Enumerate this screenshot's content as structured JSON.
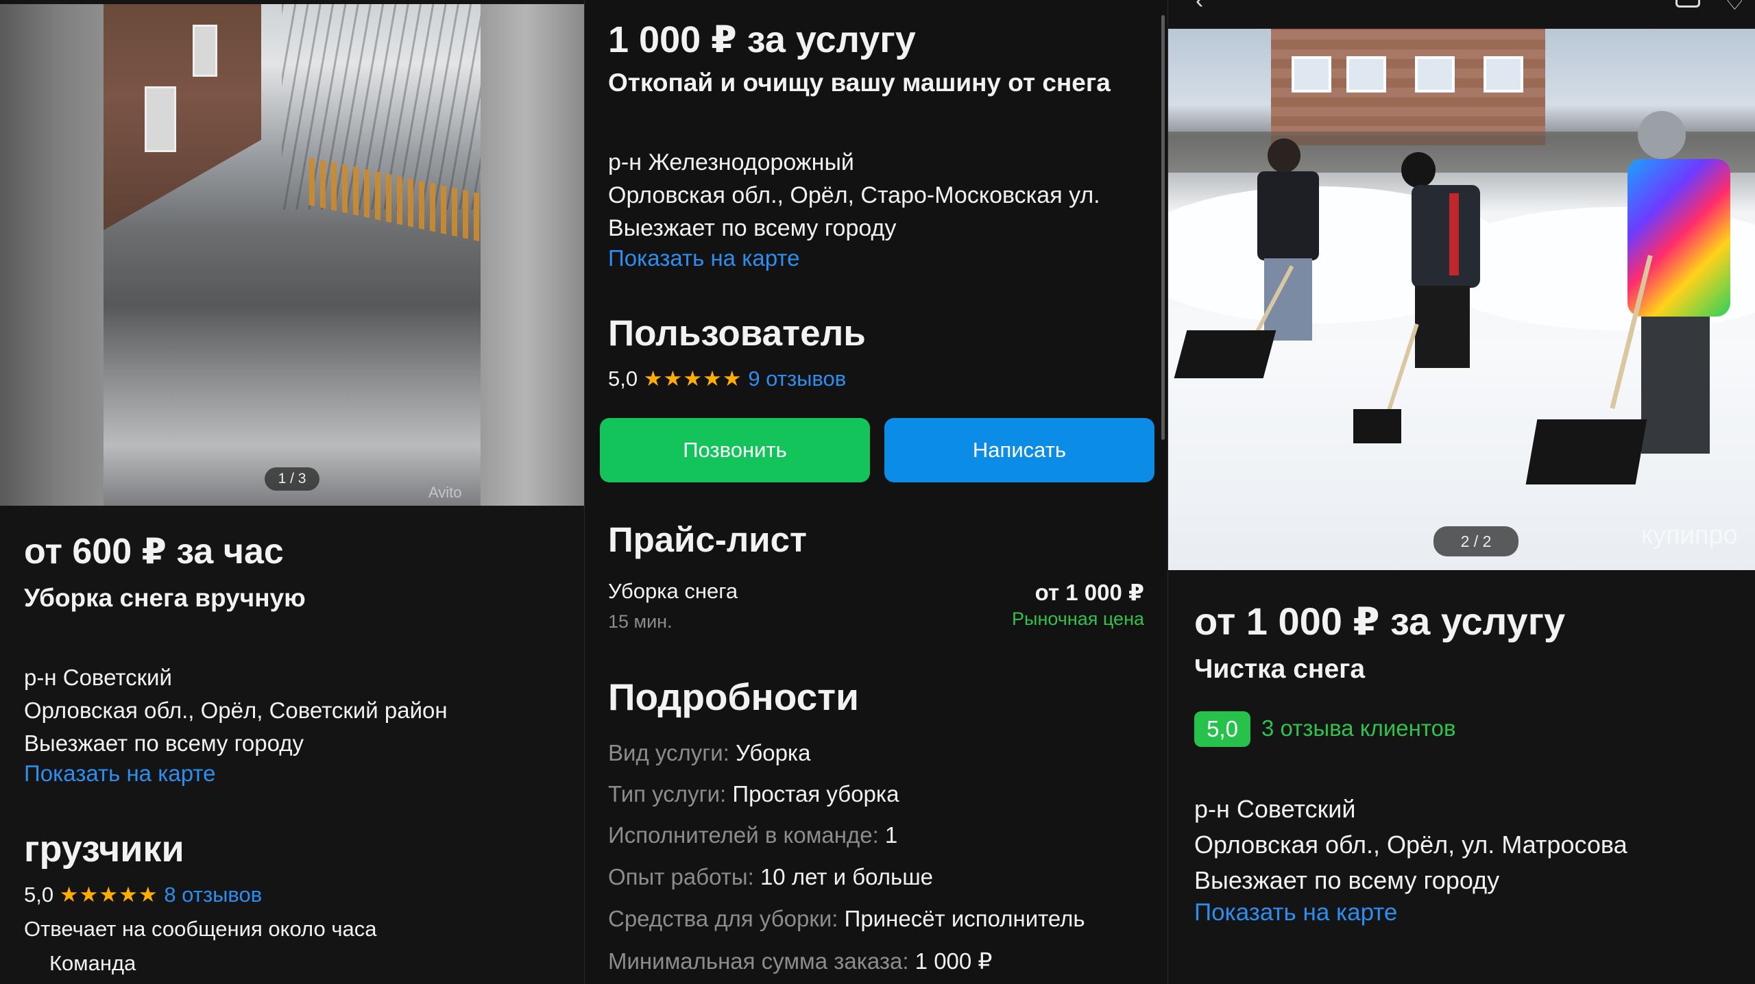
{
  "panel1": {
    "photo_counter": "1 / 3",
    "watermark": "Avito",
    "price": "от 600 ₽ за час",
    "title": "Уборка снега вручную",
    "district": "р-н Советский",
    "address": "Орловская обл., Орёл, Советский район",
    "coverage": "Выезжает по всему городу",
    "map_link": "Показать на карте",
    "seller_name": "грузчики",
    "rating_value": "5,0",
    "stars": "★★★★★",
    "reviews_link": "8 отзывов",
    "response_time": "Отвечает на сообщения около часа",
    "seller_type": "Команда"
  },
  "panel2": {
    "price": "1 000 ₽ за услугу",
    "title": "Откопай и очищу вашу машину от снега",
    "district": "р-н Железнодорожный",
    "address": "Орловская обл., Орёл, Старо-Московская ул.",
    "coverage": "Выезжает по всему городу",
    "map_link": "Показать на карте",
    "seller_heading": "Пользователь",
    "rating_value": "5,0",
    "stars": "★★★★★",
    "reviews_link": "9 отзывов",
    "call_button": "Позвонить",
    "write_button": "Написать",
    "pricelist_heading": "Прайс-лист",
    "pricelist_item": {
      "name": "Уборка снега",
      "duration": "15 мин.",
      "price": "от 1 000 ₽",
      "note": "Рыночная цена"
    },
    "details_heading": "Подробности",
    "details": [
      {
        "label": "Вид услуги:",
        "value": "Уборка"
      },
      {
        "label": "Тип услуги:",
        "value": "Простая уборка"
      },
      {
        "label": "Исполнителей в команде:",
        "value": "1"
      },
      {
        "label": "Опыт работы:",
        "value": "10 лет и больше"
      },
      {
        "label": "Средства для уборки:",
        "value": "Принесёт исполнитель"
      },
      {
        "label": "Минимальная сумма заказа:",
        "value": "1 000 ₽"
      }
    ]
  },
  "panel3": {
    "photo_counter": "2 / 2",
    "watermark": "купипро",
    "price": "от 1 000 ₽ за услугу",
    "title": "Чистка снега",
    "score": "5,0",
    "reviews_link": "3 отзыва клиентов",
    "district": "р-н Советский",
    "address": "Орловская обл., Орёл, ул. Матросова",
    "coverage": "Выезжает по всему городу",
    "map_link": "Показать на карте",
    "colors": {
      "accent": "#2b8ef0",
      "call": "#12c45a",
      "write": "#0b8ce6",
      "score": "#27c24c",
      "star": "#ffad00"
    }
  }
}
